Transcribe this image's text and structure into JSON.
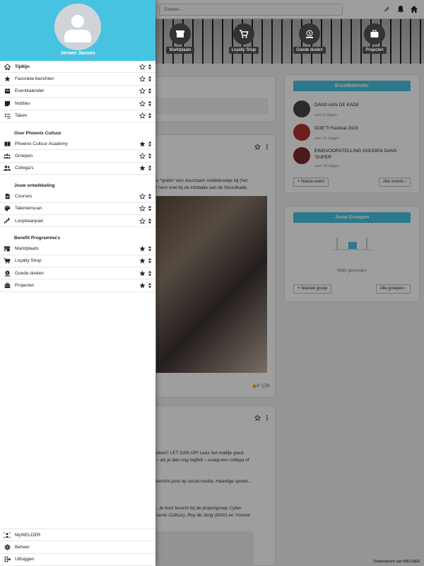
{
  "topbar": {
    "search_placeholder": "Zoeken..."
  },
  "hero": {
    "tiles": [
      {
        "label": "Marktplaats",
        "icon": "storefront-icon"
      },
      {
        "label": "Loyalty Shop",
        "icon": "cart-icon"
      },
      {
        "label": "Goede doelen",
        "icon": "donation-icon"
      },
      {
        "label": "Projecten",
        "icon": "briefcase-icon"
      }
    ]
  },
  "events_widget": {
    "title": "Eventkalender",
    "events": [
      {
        "title": "DANS AAN DE KADE",
        "date": "over 3 dagen"
      },
      {
        "title": "DOE'T! Festival 2023",
        "date": "over 11 dagen"
      },
      {
        "title_line1": "EINDVOORSTELLING GOUDEN DANS",
        "title_line2": "'SUPER'",
        "date": "over 18 dagen"
      }
    ],
    "new_button": "Nieuw event",
    "all_button": "Alle events"
  },
  "groups_widget": {
    "title": "Jouw Groepen",
    "empty_text": "Niets gevonden",
    "new_button": "Nieuwe groep",
    "all_button": "Alle groepen"
  },
  "post1": {
    "text_line1": "e *gratis* een duurzaam notitieboekje bij (het",
    "text_line2": "l hem snel bij de infobalie van de Noordkade.",
    "likes": "0",
    "comments": "0"
  },
  "post2": {
    "line1": "eken? LET DAN OP! Lees het mailtje goed.",
    "line2": "– als je dan nog twijfelt – vraag een collega of",
    "line3": "bericht post op social media. Haastige spoed...",
    "line4": ". Je kunt terecht bij de projectgroep Cyber",
    "line5": "oenix Cultuur), Roy de Jong (DNV) en Yvonne"
  },
  "drawer": {
    "user_name": "Jeroen Jansen",
    "main_items": [
      {
        "label": "Tijdlijn",
        "icon": "home-icon",
        "starred": false,
        "active": true
      },
      {
        "label": "Favoriete berichten",
        "icon": "star-icon",
        "starred": false,
        "active": false
      },
      {
        "label": "Eventkalender",
        "icon": "calendar-icon",
        "starred": false,
        "active": false
      },
      {
        "label": "Notities",
        "icon": "note-icon",
        "starred": false,
        "active": false
      },
      {
        "label": "Taken",
        "icon": "tasks-icon",
        "starred": false,
        "active": false
      }
    ],
    "sections": [
      {
        "title": "Over Phoenix Cultuur",
        "items": [
          {
            "label": "Phoenix Cultuur Academy",
            "icon": "book-icon",
            "starred": true
          },
          {
            "label": "Groepen",
            "icon": "groups-icon",
            "starred": false
          },
          {
            "label": "Collega's",
            "icon": "people-icon",
            "starred": true
          }
        ]
      },
      {
        "title": "Jouw ontwikkeling",
        "items": [
          {
            "label": "Courses",
            "icon": "document-icon",
            "starred": false
          },
          {
            "label": "Talentenscan",
            "icon": "palette-icon",
            "starred": false
          },
          {
            "label": "Loopbaanpad",
            "icon": "path-icon",
            "starred": false
          }
        ]
      },
      {
        "title": "Benefit Programma's",
        "items": [
          {
            "label": "Marktplaats",
            "icon": "storefront-icon",
            "starred": true
          },
          {
            "label": "Loyalty Shop",
            "icon": "cart-icon",
            "starred": true
          },
          {
            "label": "Goede doelen",
            "icon": "donation-icon",
            "starred": true
          },
          {
            "label": "Projecten",
            "icon": "briefcase-icon",
            "starred": true
          }
        ]
      }
    ],
    "footer_items": [
      {
        "label": "MyWELDER",
        "icon": "mywelder-icon"
      },
      {
        "label": "Beheer",
        "icon": "gear-icon"
      },
      {
        "label": "Uitloggen",
        "icon": "logout-icon"
      }
    ]
  },
  "credit": "Ondersteunt van WELDER",
  "colors": {
    "accent": "#46c3e0"
  }
}
